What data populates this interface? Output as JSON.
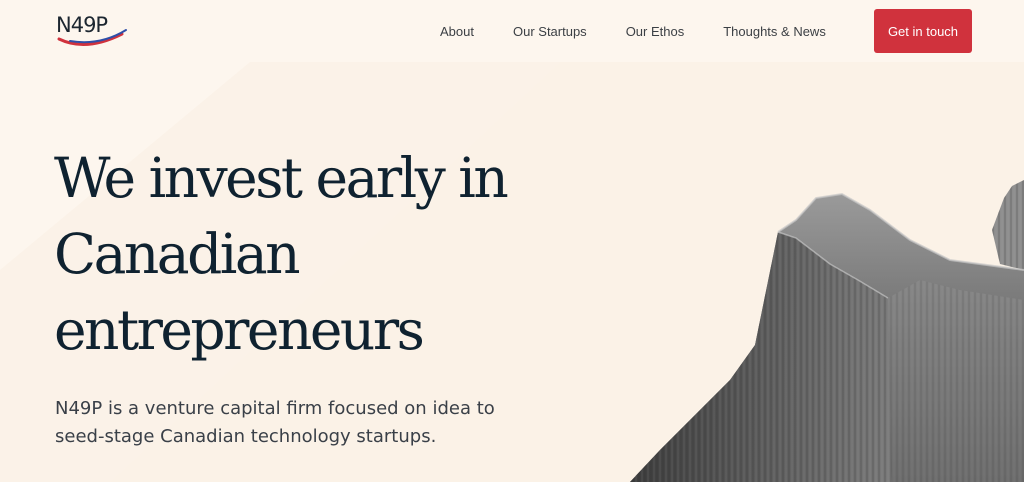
{
  "logo": {
    "text": "N49P",
    "colors": [
      "#d0323d",
      "#2f4fa8"
    ]
  },
  "nav": {
    "items": [
      "About",
      "Our Startups",
      "Our Ethos",
      "Thoughts & News"
    ]
  },
  "cta": {
    "label": "Get in touch"
  },
  "hero": {
    "headline": [
      "We invest early in",
      "Canadian",
      "entrepreneurs"
    ],
    "subtitle": [
      "N49P is a venture capital firm focused on idea to",
      "seed-stage Canadian technology startups."
    ]
  },
  "image": {
    "icon": "mountain-image"
  },
  "colors": {
    "background": "#fdf6ee",
    "accent": "#d0323d",
    "text": "#0f2230"
  }
}
